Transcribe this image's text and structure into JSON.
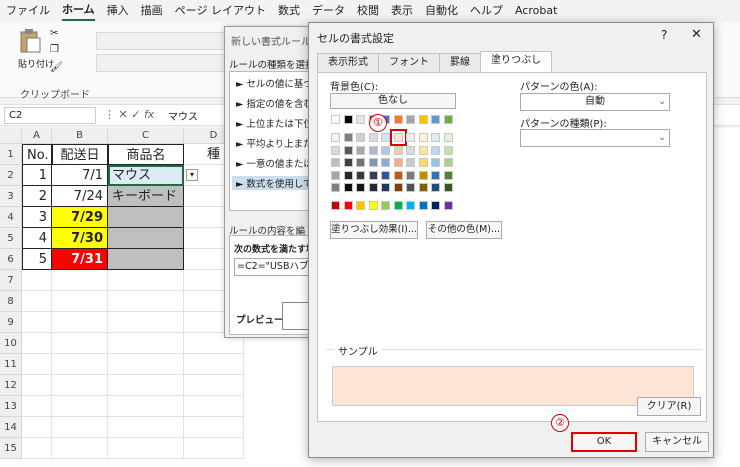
{
  "ribbon": {
    "tabs": [
      "ファイル",
      "ホーム",
      "挿入",
      "描画",
      "ページ レイアウト",
      "数式",
      "データ",
      "校閲",
      "表示",
      "自動化",
      "ヘルプ",
      "Acrobat"
    ],
    "active_tab_index": 1,
    "paste_label": "貼り付け",
    "clipboard_label": "クリップボード"
  },
  "formula_bar": {
    "name_box": "C2",
    "value": "マウス"
  },
  "sheet": {
    "columns": [
      "A",
      "B",
      "C",
      "D"
    ],
    "rows": [
      "1",
      "2",
      "3",
      "4",
      "5",
      "6",
      "7",
      "8",
      "9",
      "10",
      "11",
      "12",
      "13",
      "14",
      "15"
    ],
    "header": [
      "No.",
      "配送日",
      "商品名",
      "種"
    ],
    "data": [
      {
        "no": "1",
        "date": "7/1",
        "item": "マウス"
      },
      {
        "no": "2",
        "date": "7/24",
        "item": "キーボード"
      },
      {
        "no": "3",
        "date": "7/29",
        "item": ""
      },
      {
        "no": "4",
        "date": "7/30",
        "item": ""
      },
      {
        "no": "5",
        "date": "7/31",
        "item": ""
      }
    ],
    "colors": {
      "yellow": "#ffff00",
      "red": "#ff0000",
      "blue_light": "#ddebf7",
      "gray": "#bfbfbf"
    }
  },
  "rule_dialog": {
    "title": "新しい書式ルール",
    "select_label": "ルールの種類を選択し",
    "items": [
      "► セルの値に基づいて",
      "► 指定の値を含むセ",
      "► 上位または下位に",
      "► 平均より上または下",
      "► 一意の値または重",
      "► 数式を使用して、"
    ],
    "edit_label": "ルールの内容を編集して",
    "formula_label": "次の数式を満たす場",
    "formula": "=C2=\"USBハブ\"",
    "preview_label": "プレビュー:"
  },
  "format_dialog": {
    "title": "セルの書式設定",
    "help": "?",
    "close": "✕",
    "tabs": [
      "表示形式",
      "フォント",
      "罫線",
      "塗りつぶし"
    ],
    "active_tab_index": 3,
    "bg_color_label": "背景色(C):",
    "no_color": "色なし",
    "fill_effects": "塗りつぶし効果(I)...",
    "more_colors": "その他の色(M)...",
    "pattern_color_label": "パターンの色(A):",
    "pattern_color_value": "自動",
    "pattern_type_label": "パターンの種類(P):",
    "sample_label": "サンプル",
    "sample_color": "#fce4d6",
    "clear": "クリア(R)",
    "ok": "OK",
    "cancel": "キャンセル"
  },
  "palette": {
    "theme_row": [
      "#ffffff",
      "#000000",
      "#e7e6e6",
      "#44546a",
      "#4472c4",
      "#ed7d31",
      "#a5a5a5",
      "#ffc000",
      "#5b9bd5",
      "#70ad47"
    ],
    "tints": [
      [
        "#f2f2f2",
        "#7f7f7f",
        "#d0cece",
        "#d6dce4",
        "#d9e1f2",
        "#fce4d6",
        "#ededed",
        "#fff2cc",
        "#ddebf7",
        "#e2efda"
      ],
      [
        "#d9d9d9",
        "#595959",
        "#aeaaaa",
        "#acb9ca",
        "#b4c6e7",
        "#f8cbad",
        "#dbdbdb",
        "#ffe699",
        "#bdd7ee",
        "#c6e0b4"
      ],
      [
        "#bfbfbf",
        "#404040",
        "#757171",
        "#8497b0",
        "#8ea9db",
        "#f4b084",
        "#c9c9c9",
        "#ffd966",
        "#9bc2e6",
        "#a9d08e"
      ],
      [
        "#a6a6a6",
        "#262626",
        "#3a3838",
        "#333f4f",
        "#2f5496",
        "#c65911",
        "#7b7b7b",
        "#bf8f00",
        "#2e75b6",
        "#548235"
      ],
      [
        "#808080",
        "#0d0d0d",
        "#161616",
        "#222b35",
        "#203764",
        "#833c0c",
        "#525252",
        "#806000",
        "#1f4e78",
        "#375623"
      ]
    ],
    "standard": [
      "#c00000",
      "#ff0000",
      "#ffc000",
      "#ffff00",
      "#92d050",
      "#00b050",
      "#00b0f0",
      "#0070c0",
      "#002060",
      "#7030a0"
    ],
    "selected": "tint-0-5"
  },
  "annotations": {
    "step1": "①",
    "step2": "②"
  }
}
